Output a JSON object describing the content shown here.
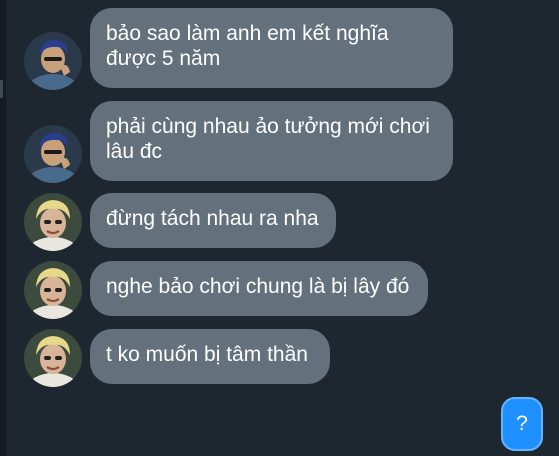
{
  "messages": [
    {
      "lines": [
        "bảo sao làm anh em kết nghĩa",
        "được 5 năm"
      ],
      "sender": "user-a"
    },
    {
      "lines": [
        "phải cùng nhau ảo tưởng mới chơi",
        "lâu đc"
      ],
      "sender": "user-a"
    },
    {
      "lines": [
        "đừng tách nhau ra nha"
      ],
      "sender": "user-b"
    },
    {
      "lines": [
        "nghe bảo chơi chung là bị lây đó"
      ],
      "sender": "user-b"
    },
    {
      "lines": [
        "t ko muốn bị tâm thần"
      ],
      "sender": "user-b"
    }
  ],
  "help_button": {
    "label": "?",
    "icon": "help-icon"
  },
  "colors": {
    "background": "#1e2730",
    "bubble": "#64717d",
    "text": "#ffffff",
    "help_button": "#1e90ff"
  }
}
